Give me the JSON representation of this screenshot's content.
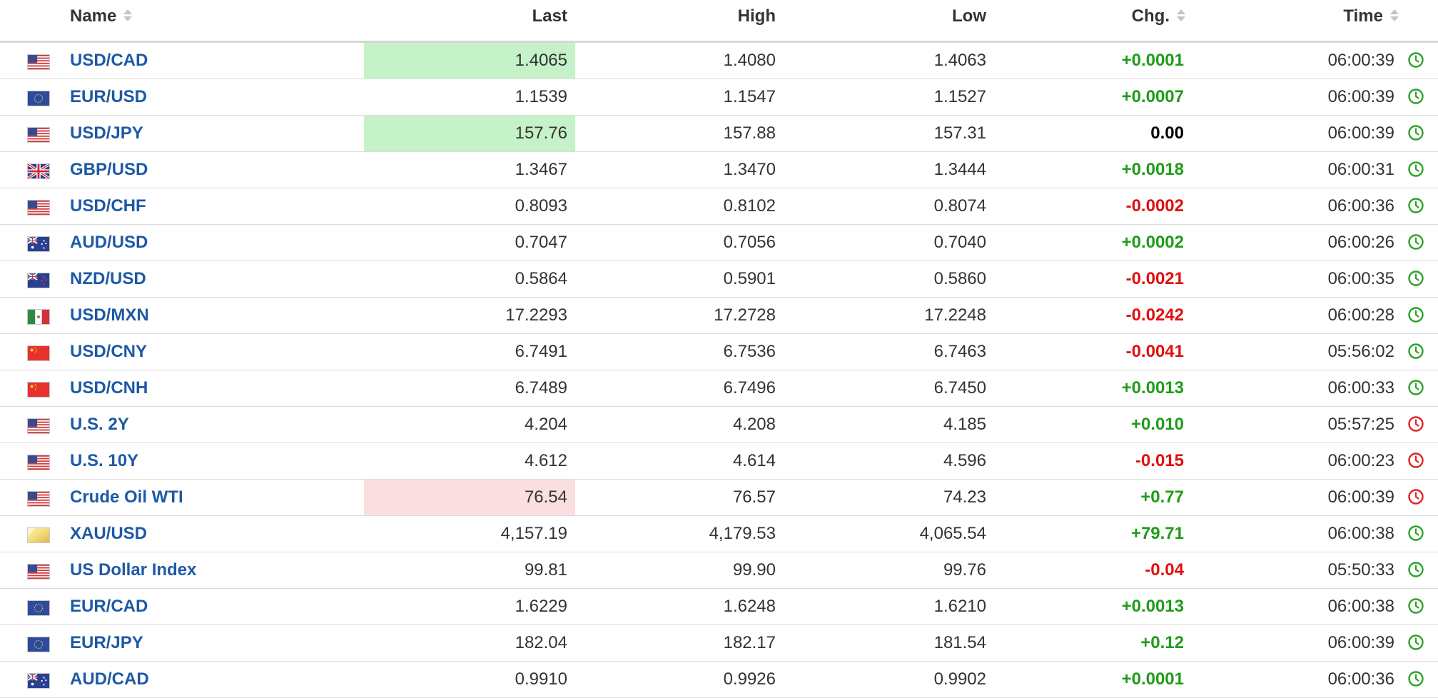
{
  "header": {
    "name": "Name",
    "last": "Last",
    "high": "High",
    "low": "Low",
    "chg": "Chg.",
    "time": "Time"
  },
  "colors": {
    "link": "#1d59a5",
    "positive": "#1f9c1a",
    "negative": "#e01010",
    "highlight_up": "#c5f2c9",
    "highlight_down": "#fbdfe0",
    "clock_live": "#2fa12a",
    "clock_delayed": "#e02424"
  },
  "rows": [
    {
      "name": "USD/CAD",
      "flag": "us-flag-icon",
      "last": "1.4065",
      "high": "1.4080",
      "low": "1.4063",
      "chg": "+0.0001",
      "dir": "pos",
      "time": "06:00:39",
      "clock": "live",
      "highlight": "up"
    },
    {
      "name": "EUR/USD",
      "flag": "eu-flag-icon",
      "last": "1.1539",
      "high": "1.1547",
      "low": "1.1527",
      "chg": "+0.0007",
      "dir": "pos",
      "time": "06:00:39",
      "clock": "live",
      "highlight": ""
    },
    {
      "name": "USD/JPY",
      "flag": "us-flag-icon",
      "last": "157.76",
      "high": "157.88",
      "low": "157.31",
      "chg": "0.00",
      "dir": "zero",
      "time": "06:00:39",
      "clock": "live",
      "highlight": "up"
    },
    {
      "name": "GBP/USD",
      "flag": "uk-flag-icon",
      "last": "1.3467",
      "high": "1.3470",
      "low": "1.3444",
      "chg": "+0.0018",
      "dir": "pos",
      "time": "06:00:31",
      "clock": "live",
      "highlight": ""
    },
    {
      "name": "USD/CHF",
      "flag": "us-flag-icon",
      "last": "0.8093",
      "high": "0.8102",
      "low": "0.8074",
      "chg": "-0.0002",
      "dir": "neg",
      "time": "06:00:36",
      "clock": "live",
      "highlight": ""
    },
    {
      "name": "AUD/USD",
      "flag": "au-flag-icon",
      "last": "0.7047",
      "high": "0.7056",
      "low": "0.7040",
      "chg": "+0.0002",
      "dir": "pos",
      "time": "06:00:26",
      "clock": "live",
      "highlight": ""
    },
    {
      "name": "NZD/USD",
      "flag": "nz-flag-icon",
      "last": "0.5864",
      "high": "0.5901",
      "low": "0.5860",
      "chg": "-0.0021",
      "dir": "neg",
      "time": "06:00:35",
      "clock": "live",
      "highlight": ""
    },
    {
      "name": "USD/MXN",
      "flag": "mx-flag-icon",
      "last": "17.2293",
      "high": "17.2728",
      "low": "17.2248",
      "chg": "-0.0242",
      "dir": "neg",
      "time": "06:00:28",
      "clock": "live",
      "highlight": ""
    },
    {
      "name": "USD/CNY",
      "flag": "cn-flag-icon",
      "last": "6.7491",
      "high": "6.7536",
      "low": "6.7463",
      "chg": "-0.0041",
      "dir": "neg",
      "time": "05:56:02",
      "clock": "live",
      "highlight": ""
    },
    {
      "name": "USD/CNH",
      "flag": "cn-flag-icon",
      "last": "6.7489",
      "high": "6.7496",
      "low": "6.7450",
      "chg": "+0.0013",
      "dir": "pos",
      "time": "06:00:33",
      "clock": "live",
      "highlight": ""
    },
    {
      "name": "U.S. 2Y",
      "flag": "us-flag-icon",
      "last": "4.204",
      "high": "4.208",
      "low": "4.185",
      "chg": "+0.010",
      "dir": "pos",
      "time": "05:57:25",
      "clock": "delayed",
      "highlight": ""
    },
    {
      "name": "U.S. 10Y",
      "flag": "us-flag-icon",
      "last": "4.612",
      "high": "4.614",
      "low": "4.596",
      "chg": "-0.015",
      "dir": "neg",
      "time": "06:00:23",
      "clock": "delayed",
      "highlight": ""
    },
    {
      "name": "Crude Oil WTI",
      "flag": "us-flag-icon",
      "last": "76.54",
      "high": "76.57",
      "low": "74.23",
      "chg": "+0.77",
      "dir": "pos",
      "time": "06:00:39",
      "clock": "delayed",
      "highlight": "down"
    },
    {
      "name": "XAU/USD",
      "flag": "gold-icon",
      "last": "4,157.19",
      "high": "4,179.53",
      "low": "4,065.54",
      "chg": "+79.71",
      "dir": "pos",
      "time": "06:00:38",
      "clock": "live",
      "highlight": ""
    },
    {
      "name": "US Dollar Index",
      "flag": "us-flag-icon",
      "last": "99.81",
      "high": "99.90",
      "low": "99.76",
      "chg": "-0.04",
      "dir": "neg",
      "time": "05:50:33",
      "clock": "live",
      "highlight": ""
    },
    {
      "name": "EUR/CAD",
      "flag": "eu-flag-icon",
      "last": "1.6229",
      "high": "1.6248",
      "low": "1.6210",
      "chg": "+0.0013",
      "dir": "pos",
      "time": "06:00:38",
      "clock": "live",
      "highlight": ""
    },
    {
      "name": "EUR/JPY",
      "flag": "eu-flag-icon",
      "last": "182.04",
      "high": "182.17",
      "low": "181.54",
      "chg": "+0.12",
      "dir": "pos",
      "time": "06:00:39",
      "clock": "live",
      "highlight": ""
    },
    {
      "name": "AUD/CAD",
      "flag": "au-flag-icon",
      "last": "0.9910",
      "high": "0.9926",
      "low": "0.9902",
      "chg": "+0.0001",
      "dir": "pos",
      "time": "06:00:36",
      "clock": "live",
      "highlight": ""
    }
  ]
}
